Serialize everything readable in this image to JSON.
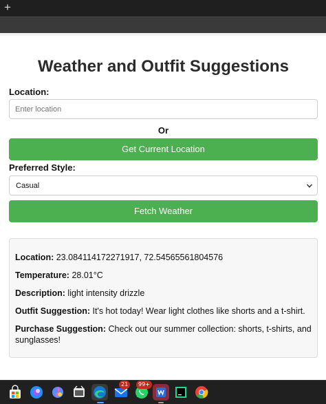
{
  "browser": {
    "new_tab_glyph": "+"
  },
  "app": {
    "title": "Weather and Outfit Suggestions",
    "location_label": "Location:",
    "location_placeholder": "Enter location",
    "location_value": "",
    "or_text": "Or",
    "current_location_button": "Get Current Location",
    "style_label": "Preferred Style:",
    "style_selected": "Casual",
    "fetch_button": "Fetch Weather",
    "accent_color": "#4caf50"
  },
  "results": {
    "location_label": "Location:",
    "location_value": "23.084114172271917, 72.54565561804576",
    "temperature_label": "Temperature:",
    "temperature_value": "28.01°C",
    "description_label": "Description:",
    "description_value": "light intensity drizzle",
    "outfit_label": "Outfit Suggestion:",
    "outfit_value": "It's hot today! Wear light clothes like shorts and a t-shirt.",
    "purchase_label": "Purchase Suggestion:",
    "purchase_value": "Check out our summer collection: shorts, t-shirts, and sunglasses!"
  },
  "taskbar": {
    "icons": [
      "store-icon",
      "copilot-icon",
      "gallery-icon",
      "media-icon",
      "edge-icon",
      "mail-icon",
      "whatsapp-icon",
      "word-icon",
      "pycharm-icon",
      "chrome-icon"
    ],
    "mail_badge": "21",
    "whatsapp_badge": "99+"
  }
}
